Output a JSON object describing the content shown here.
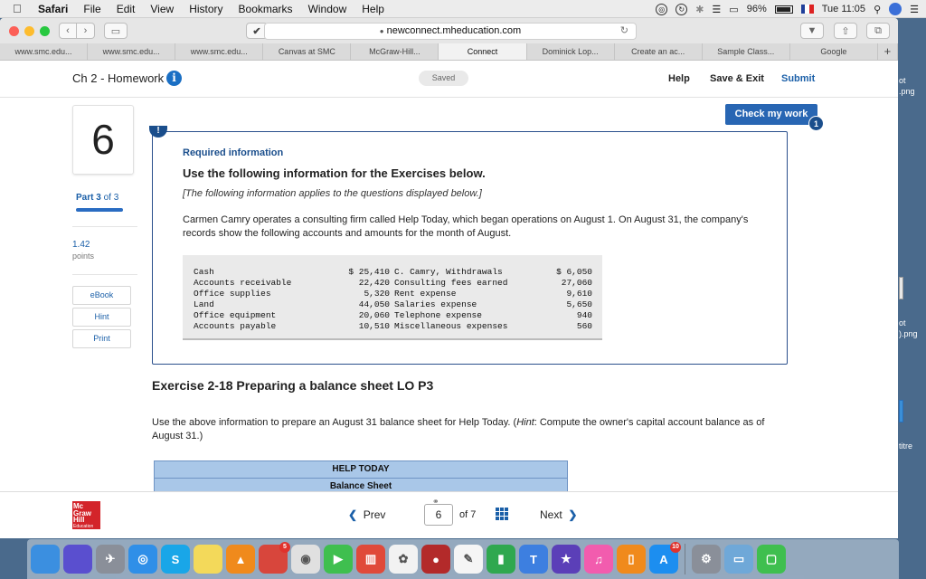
{
  "menubar": {
    "app": "Safari",
    "items": [
      "File",
      "Edit",
      "View",
      "History",
      "Bookmarks",
      "Window",
      "Help"
    ],
    "battery": "96%",
    "time": "Tue 11:05"
  },
  "browser": {
    "url": "newconnect.mheducation.com",
    "tabs": [
      "www.smc.edu...",
      "www.smc.edu...",
      "www.smc.edu...",
      "Canvas at SMC",
      "McGraw-Hill...",
      "Connect",
      "Dominick Lop...",
      "Create an ac...",
      "Sample Class...",
      "Google"
    ],
    "active_tab_index": 5,
    "new_tab": "+"
  },
  "header": {
    "title": "Ch 2 - Homework",
    "info_icon": "i",
    "saved": "Saved",
    "help": "Help",
    "save_exit": "Save & Exit",
    "submit": "Submit",
    "check_button": "Check my work",
    "check_badge": "1"
  },
  "sidebar": {
    "question_number": "6",
    "part_label": "Part 3",
    "part_of": "of 3",
    "points_value": "1.42",
    "points_unit": "points",
    "buttons": [
      "eBook",
      "Hint",
      "Print"
    ]
  },
  "info_card": {
    "flag": "!",
    "required": "Required information",
    "heading": "Use the following information for the Exercises below.",
    "applies": "[The following information applies to the questions displayed below.]",
    "paragraph": "Carmen Camry operates a consulting firm called Help Today, which began operations on August 1. On August 31, the company's records show the following accounts and amounts for the month of August.",
    "accounts": [
      {
        "name1": "Cash",
        "amt1": "$ 25,410",
        "name2": "C. Camry, Withdrawals",
        "amt2": "$ 6,050"
      },
      {
        "name1": "Accounts receivable",
        "amt1": "22,420",
        "name2": "Consulting fees earned",
        "amt2": "27,060"
      },
      {
        "name1": "Office supplies",
        "amt1": "5,320",
        "name2": "Rent expense",
        "amt2": "9,610"
      },
      {
        "name1": "Land",
        "amt1": "44,050",
        "name2": "Salaries expense",
        "amt2": "5,650"
      },
      {
        "name1": "Office equipment",
        "amt1": "20,060",
        "name2": "Telephone expense",
        "amt2": "940"
      },
      {
        "name1": "Accounts payable",
        "amt1": "10,510",
        "name2": "Miscellaneous expenses",
        "amt2": "560"
      }
    ]
  },
  "exercise": {
    "title": "Exercise 2-18 Preparing a balance sheet LO P3",
    "instructions_pre": "Use the above information to prepare an August 31 balance sheet for Help Today. (",
    "hint_word": "Hint",
    "instructions_post": ": Compute the owner's capital account balance as of August 31.)",
    "table_header_1": "HELP TODAY",
    "table_header_2": "Balance Sheet"
  },
  "footer": {
    "logo_lines": [
      "Mc",
      "Graw",
      "Hill"
    ],
    "logo_sub": "Education",
    "prev": "Prev",
    "current_page": "6",
    "of_total": "of 7",
    "next": "Next"
  },
  "desktop": {
    "labels": [
      "ot",
      ".png",
      "ot",
      ").png",
      "titre"
    ]
  },
  "dock": {
    "icons": [
      {
        "name": "finder-icon",
        "color": "#3b8fe0",
        "glyph": ""
      },
      {
        "name": "siri-icon",
        "color": "#5a4fcf",
        "glyph": ""
      },
      {
        "name": "launchpad-icon",
        "color": "#8a8f99",
        "glyph": "✈"
      },
      {
        "name": "safari-icon",
        "color": "#2f8fe8",
        "glyph": "◎"
      },
      {
        "name": "skype-icon",
        "color": "#19a6e8",
        "glyph": "S"
      },
      {
        "name": "notes-icon",
        "color": "#f3d95a",
        "glyph": ""
      },
      {
        "name": "vlc-icon",
        "color": "#f08a1c",
        "glyph": "▲"
      },
      {
        "name": "messenger-icon",
        "color": "#d8463c",
        "glyph": "",
        "badge": "5"
      },
      {
        "name": "chrome-icon",
        "color": "#e0e0e0",
        "glyph": "◉"
      },
      {
        "name": "facetime-icon",
        "color": "#3fbf4f",
        "glyph": "▶"
      },
      {
        "name": "popcorn-icon",
        "color": "#e04a3a",
        "glyph": "▥"
      },
      {
        "name": "photos-icon",
        "color": "#f2f2f2",
        "glyph": "✿"
      },
      {
        "name": "photobooth-icon",
        "color": "#b32a2a",
        "glyph": "●"
      },
      {
        "name": "textedit-icon",
        "color": "#f5f5f5",
        "glyph": "✎"
      },
      {
        "name": "numbers-icon",
        "color": "#2fa84f",
        "glyph": "▮"
      },
      {
        "name": "keynote-icon",
        "color": "#3d7fe0",
        "glyph": "T"
      },
      {
        "name": "imovie-icon",
        "color": "#5b3fb8",
        "glyph": "★"
      },
      {
        "name": "itunes-icon",
        "color": "#f25cae",
        "glyph": "♫"
      },
      {
        "name": "ibooks-icon",
        "color": "#f08a1c",
        "glyph": "▯"
      },
      {
        "name": "appstore-icon",
        "color": "#1c8ef0",
        "glyph": "A",
        "badge": "10"
      },
      {
        "name": "system-preferences-icon",
        "color": "#8a8f99",
        "glyph": "⚙"
      },
      {
        "name": "preview-icon",
        "color": "#6fa8d8",
        "glyph": "▭"
      },
      {
        "name": "messages-icon",
        "color": "#3fbf4f",
        "glyph": "▢"
      }
    ]
  }
}
